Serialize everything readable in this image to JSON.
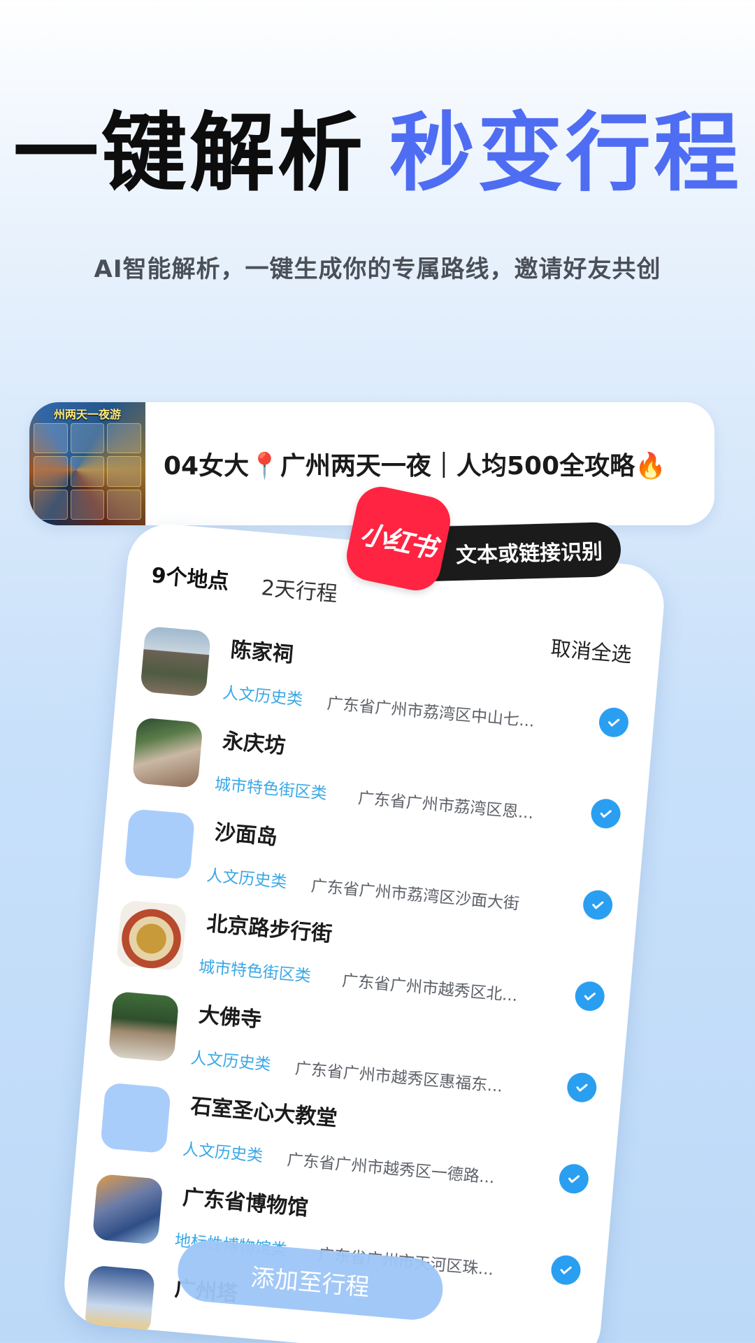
{
  "hero": {
    "title_black": "一键解析",
    "title_blue": "秒变行程",
    "subtitle": "AI智能解析，一键生成你的专属路线，邀请好友共创"
  },
  "note": {
    "thumb_caption": "州两天一夜游",
    "title": "04女大📍广州两天一夜｜人均500全攻略🔥"
  },
  "badge": {
    "logo_text": "小红书",
    "text": "文本或链接识别"
  },
  "list_card": {
    "tab_places": "9个地点",
    "tab_days": "2天行程",
    "deselect_all": "取消全选",
    "add_button": "添加至行程",
    "items": [
      {
        "name": "陈家祠",
        "category": "人文历史类",
        "address": "广东省广州市荔湾区中山七...",
        "thumb": "ancestral",
        "checked": true
      },
      {
        "name": "永庆坊",
        "category": "城市特色街区类",
        "address": "广东省广州市荔湾区恩...",
        "thumb": "street",
        "checked": true
      },
      {
        "name": "沙面岛",
        "category": "人文历史类",
        "address": "广东省广州市荔湾区沙面大街",
        "thumb": "placeholder",
        "checked": true
      },
      {
        "name": "北京路步行街",
        "category": "城市特色街区类",
        "address": "广东省广州市越秀区北...",
        "thumb": "food",
        "checked": true
      },
      {
        "name": "大佛寺",
        "category": "人文历史类",
        "address": "广东省广州市越秀区惠福东...",
        "thumb": "temple",
        "checked": true
      },
      {
        "name": "石室圣心大教堂",
        "category": "人文历史类",
        "address": "广东省广州市越秀区一德路...",
        "thumb": "placeholder",
        "checked": true
      },
      {
        "name": "广东省博物馆",
        "category": "地标性博物馆类",
        "address": "广东省广州市天河区珠...",
        "thumb": "museum",
        "checked": true
      },
      {
        "name": "广州塔",
        "category": "",
        "address": "",
        "thumb": "tower",
        "checked": true
      }
    ]
  },
  "colors": {
    "accent_blue": "#4f6df2",
    "check_blue": "#2a9ff1",
    "category_blue": "#39a8e6",
    "xhs_red": "#ff2442"
  }
}
